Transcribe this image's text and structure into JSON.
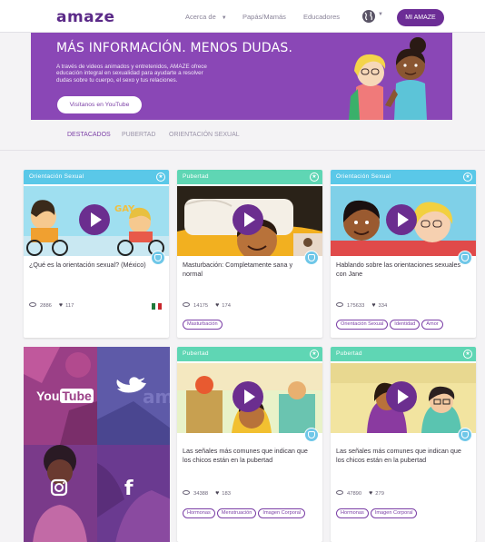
{
  "nav": {
    "logo": "amaze",
    "about": "Acerca de",
    "parents": "Papás/Mamás",
    "educators": "Educadores",
    "my_amaze": "MI AMAZE",
    "globe_icon": "globe-icon"
  },
  "hero": {
    "title": "MÁS INFORMACIÓN. MENOS DUDAS.",
    "text": "A través de videos animados y entretenidos, AMAZE ofrece educación integral en sexualidad para ayudarte a resolver dudas sobre tu cuerpo, el sexo y tus relaciones.",
    "button": "Visítanos en YouTube"
  },
  "tabs": [
    {
      "label": "DESTACADOS",
      "active": true
    },
    {
      "label": "PUBERTAD",
      "active": false
    },
    {
      "label": "ORIENTACIÓN SEXUAL",
      "active": false
    }
  ],
  "cards": [
    {
      "category": "Orientación Sexual",
      "category_color": "#5ac8e8",
      "title": "¿Qué es la orientación sexual? (México)",
      "views": "2886",
      "likes": "117",
      "flag": [
        "#1f7a3a",
        "#ffffff",
        "#c8262c"
      ],
      "tags": [],
      "thumb_word": "GAY"
    },
    {
      "category": "Pubertad",
      "category_color": "#5fd6b4",
      "title": "Masturbación: Completamente sana y normal",
      "views": "14175",
      "likes": "174",
      "tags": [
        "Masturbación"
      ]
    },
    {
      "category": "Orientación Sexual",
      "category_color": "#5ac8e8",
      "title": "Hablando sobre las orientaciones sexuales con Jane",
      "views": "175633",
      "likes": "334",
      "tags": [
        "Orientación Sexual",
        "Identidad",
        "Amor"
      ]
    },
    {
      "category": "Pubertad",
      "category_color": "#5fd6b4",
      "title": "Las señales más comunes que indican que los chicos están en la pubertad",
      "views": "34388",
      "likes": "183",
      "tags": [
        "Hormonas",
        "Menstruación",
        "Imagen Corporal"
      ]
    },
    {
      "category": "Pubertad",
      "category_color": "#5fd6b4",
      "title": "Las señales más comunes que indican que los chicos están en la pubertad",
      "views": "47890",
      "likes": "279",
      "tags": [
        "Hormonas",
        "Imagen Corporal"
      ]
    }
  ],
  "social": {
    "youtube_you": "You",
    "youtube_tube": "Tube",
    "amaze": "amaz",
    "facebook": "f"
  },
  "colors": {
    "brand": "#6c2d96",
    "hero": "#8a47b6",
    "play": "#6b2e8f"
  }
}
